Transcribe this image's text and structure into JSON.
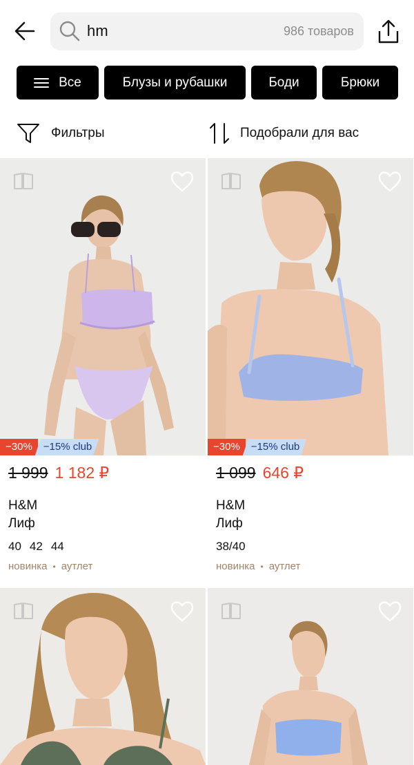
{
  "search": {
    "query": "hm",
    "count": "986 товаров"
  },
  "chips": [
    {
      "label": "Все"
    },
    {
      "label": "Блузы и рубашки"
    },
    {
      "label": "Боди"
    },
    {
      "label": "Брюки"
    }
  ],
  "controls": {
    "filters_label": "Фильтры",
    "sort_label": "Подобрали для вас"
  },
  "colors": {
    "accent_sale": "#e8452e",
    "club_badge_bg": "#c7dcf5",
    "tag_text": "#a08468"
  },
  "products": [
    {
      "badge_sale": "−30%",
      "badge_club": "−15% club",
      "old_price": "1 999",
      "new_price": "1 182 ₽",
      "brand": "H&M",
      "name": "Лиф",
      "sizes": [
        "40",
        "42",
        "44"
      ],
      "tags": [
        "новинка",
        "аутлет"
      ],
      "swimsuit_color": "#cdb6ea"
    },
    {
      "badge_sale": "−30%",
      "badge_club": "−15% club",
      "old_price": "1 099",
      "new_price": "646 ₽",
      "brand": "H&M",
      "name": "Лиф",
      "sizes": [
        "38/40"
      ],
      "tags": [
        "новинка",
        "аутлет"
      ],
      "swimsuit_color": "#9fb3e6"
    },
    {
      "swimsuit_color": "#5d6f58"
    },
    {
      "swimsuit_color": "#8fb0ea"
    }
  ]
}
